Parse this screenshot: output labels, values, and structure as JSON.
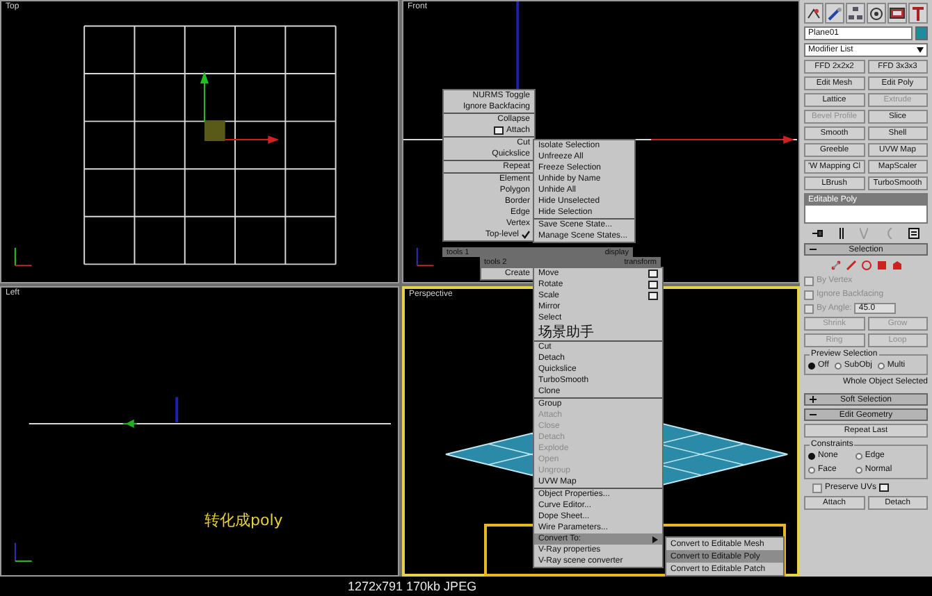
{
  "viewports": [
    {
      "label": "Top",
      "kind": "grid",
      "selected": false
    },
    {
      "label": "Front",
      "kind": "axes",
      "selected": false
    },
    {
      "label": "Left",
      "kind": "line",
      "selected": false,
      "annotation": "转化成poly"
    },
    {
      "label": "Perspective",
      "kind": "plane",
      "selected": true
    }
  ],
  "quad_menu": {
    "upper_left": {
      "groups": [
        [
          {
            "label": "NURMS Toggle",
            "kind": "normal"
          },
          {
            "label": "Ignore Backfacing",
            "kind": "normal"
          }
        ],
        [
          {
            "label": "Collapse",
            "kind": "normal"
          },
          {
            "label": "Attach",
            "kind": "options"
          }
        ],
        [
          {
            "label": "Cut",
            "kind": "normal"
          },
          {
            "label": "Quickslice",
            "kind": "normal"
          }
        ],
        [
          {
            "label": "Repeat",
            "kind": "normal"
          }
        ],
        [
          {
            "label": "Element",
            "kind": "normal"
          },
          {
            "label": "Polygon",
            "kind": "normal"
          },
          {
            "label": "Border",
            "kind": "normal"
          },
          {
            "label": "Edge",
            "kind": "normal"
          },
          {
            "label": "Vertex",
            "kind": "normal"
          },
          {
            "label": "Top-level",
            "kind": "checked"
          }
        ]
      ]
    },
    "upper_right": {
      "groups": [
        [
          {
            "label": "Isolate Selection",
            "kind": "normal"
          },
          {
            "label": "Unfreeze All",
            "kind": "normal"
          },
          {
            "label": "Freeze Selection",
            "kind": "normal"
          },
          {
            "label": "Unhide by Name",
            "kind": "normal"
          },
          {
            "label": "Unhide All",
            "kind": "normal"
          },
          {
            "label": "Hide Unselected",
            "kind": "normal"
          },
          {
            "label": "Hide Selection",
            "kind": "normal"
          }
        ],
        [
          {
            "label": "Save Scene State...",
            "kind": "normal"
          },
          {
            "label": "Manage Scene States...",
            "kind": "normal"
          }
        ]
      ]
    },
    "upper_bar": {
      "left": "tools 1",
      "right": "display"
    },
    "lower_bar": {
      "left": "tools 2",
      "right": "transform"
    },
    "lower_left": {
      "groups": [
        [
          {
            "label": "Create",
            "kind": "normal"
          }
        ]
      ]
    },
    "lower_right": {
      "groups": [
        [
          {
            "label": "Move",
            "kind": "options",
            "selected": false
          },
          {
            "label": "Rotate",
            "kind": "options",
            "selected": false
          },
          {
            "label": "Scale",
            "kind": "options",
            "selected": false
          },
          {
            "label": "Mirror",
            "kind": "normal",
            "selected": false
          },
          {
            "label": "Select",
            "kind": "normal",
            "selected": false
          },
          {
            "label": "场景助手",
            "kind": "normal",
            "selected": false
          }
        ],
        [
          {
            "label": "Cut",
            "kind": "normal",
            "selected": false
          },
          {
            "label": "Detach",
            "kind": "normal",
            "selected": false
          },
          {
            "label": "Quickslice",
            "kind": "normal",
            "selected": false
          },
          {
            "label": "TurboSmooth",
            "kind": "normal",
            "selected": false
          },
          {
            "label": "Clone",
            "kind": "normal",
            "selected": false
          }
        ],
        [
          {
            "label": "Group",
            "kind": "normal",
            "selected": false
          },
          {
            "label": "Attach",
            "kind": "disabled",
            "selected": false
          },
          {
            "label": "Close",
            "kind": "disabled",
            "selected": false
          },
          {
            "label": "Detach",
            "kind": "disabled",
            "selected": false
          },
          {
            "label": "Explode",
            "kind": "disabled",
            "selected": false
          },
          {
            "label": "Open",
            "kind": "disabled",
            "selected": false
          },
          {
            "label": "Ungroup",
            "kind": "disabled",
            "selected": false
          },
          {
            "label": "UVW Map",
            "kind": "normal",
            "selected": false
          }
        ],
        [
          {
            "label": "Object Properties...",
            "kind": "normal",
            "selected": false
          },
          {
            "label": "Curve Editor...",
            "kind": "normal",
            "selected": false
          },
          {
            "label": "Dope Sheet...",
            "kind": "normal",
            "selected": false
          },
          {
            "label": "Wire Parameters...",
            "kind": "normal",
            "selected": false
          },
          {
            "label": "Convert To:",
            "kind": "submenu",
            "selected": true
          },
          {
            "label": "V-Ray properties",
            "kind": "normal",
            "selected": false
          },
          {
            "label": "V-Ray scene converter",
            "kind": "normal",
            "selected": false
          }
        ]
      ]
    },
    "submenu": [
      {
        "label": "Convert to Editable Mesh",
        "selected": false
      },
      {
        "label": "Convert to Editable Poly",
        "selected": true
      },
      {
        "label": "Convert to Editable Patch",
        "selected": false
      }
    ]
  },
  "command_panel": {
    "object_name": "Plane01",
    "modifier_list": "Modifier List",
    "modifier_buttons": [
      {
        "label": "FFD 2x2x2",
        "disabled": false
      },
      {
        "label": "FFD 3x3x3",
        "disabled": false
      },
      {
        "label": "Edit Mesh",
        "disabled": false
      },
      {
        "label": "Edit Poly",
        "disabled": false
      },
      {
        "label": "Lattice",
        "disabled": false
      },
      {
        "label": "Extrude",
        "disabled": true
      },
      {
        "label": "Bevel Profile",
        "disabled": true
      },
      {
        "label": "Slice",
        "disabled": false
      },
      {
        "label": "Smooth",
        "disabled": false
      },
      {
        "label": "Shell",
        "disabled": false
      },
      {
        "label": "Greeble",
        "disabled": false
      },
      {
        "label": "UVW Map",
        "disabled": false
      },
      {
        "label": "'W Mapping Cl",
        "disabled": false
      },
      {
        "label": "MapScaler",
        "disabled": false
      },
      {
        "label": "LBrush",
        "disabled": false
      },
      {
        "label": "TurboSmooth",
        "disabled": false
      }
    ],
    "stack": [
      {
        "label": "Editable Poly",
        "selected": true
      }
    ],
    "selection": {
      "title": "Selection",
      "expanded": true,
      "checkboxes": [
        {
          "label": "By Vertex",
          "checked": false
        },
        {
          "label": "Ignore Backfacing",
          "checked": false
        },
        {
          "label": "By Angle:",
          "checked": false,
          "value": "45.0"
        }
      ],
      "buttons": [
        "Shrink",
        "Grow",
        "Ring",
        "Loop"
      ],
      "preview": {
        "title": "Preview Selection",
        "options": [
          {
            "label": "Off",
            "selected": true
          },
          {
            "label": "SubObj",
            "selected": false
          },
          {
            "label": "Multi",
            "selected": false
          }
        ]
      },
      "status": "Whole Object Selected"
    },
    "soft_selection": {
      "title": "Soft Selection",
      "expanded": false
    },
    "edit_geometry": {
      "title": "Edit Geometry",
      "expanded": true,
      "repeat": "Repeat Last",
      "constraints": {
        "title": "Constraints",
        "options": [
          {
            "label": "None",
            "selected": true
          },
          {
            "label": "Edge",
            "selected": false
          },
          {
            "label": "Face",
            "selected": false
          },
          {
            "label": "Normal",
            "selected": false
          }
        ]
      },
      "preserve_uvs": {
        "label": "Preserve UVs",
        "checked": false
      },
      "buttons": [
        "Attach",
        "Detach"
      ]
    }
  },
  "status_bar": "1272x791 170kb JPEG"
}
